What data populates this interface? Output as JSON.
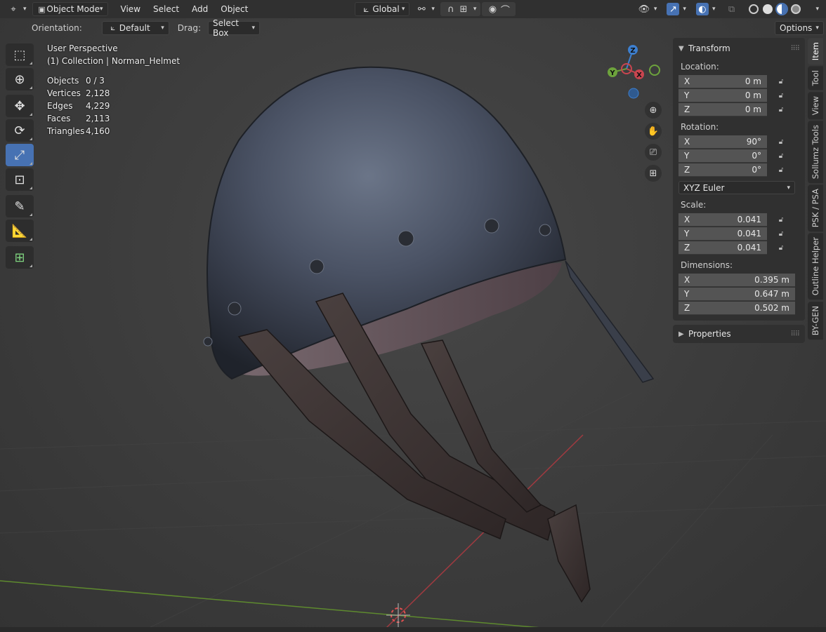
{
  "header": {
    "mode": "Object Mode",
    "menus": [
      "View",
      "Select",
      "Add",
      "Object"
    ],
    "transform_orientation": "Global"
  },
  "tool_settings": {
    "orientation_label": "Orientation:",
    "orientation_value": "Default",
    "drag_label": "Drag:",
    "drag_value": "Select Box",
    "options_label": "Options"
  },
  "overlay": {
    "perspective": "User Perspective",
    "collection": "(1) Collection | Norman_Helmet",
    "stats": [
      {
        "label": "Objects",
        "value": "0 / 3"
      },
      {
        "label": "Vertices",
        "value": "2,128"
      },
      {
        "label": "Edges",
        "value": "4,229"
      },
      {
        "label": "Faces",
        "value": "2,113"
      },
      {
        "label": "Triangles",
        "value": "4,160"
      }
    ]
  },
  "gizmo": {
    "x": "X",
    "y": "Y",
    "z": "Z"
  },
  "transform_panel": {
    "title": "Transform",
    "location_label": "Location:",
    "location": [
      {
        "axis": "X",
        "value": "0 m"
      },
      {
        "axis": "Y",
        "value": "0 m"
      },
      {
        "axis": "Z",
        "value": "0 m"
      }
    ],
    "rotation_label": "Rotation:",
    "rotation": [
      {
        "axis": "X",
        "value": "90°"
      },
      {
        "axis": "Y",
        "value": "0°"
      },
      {
        "axis": "Z",
        "value": "0°"
      }
    ],
    "rotation_mode": "XYZ Euler",
    "scale_label": "Scale:",
    "scale": [
      {
        "axis": "X",
        "value": "0.041"
      },
      {
        "axis": "Y",
        "value": "0.041"
      },
      {
        "axis": "Z",
        "value": "0.041"
      }
    ],
    "dimensions_label": "Dimensions:",
    "dimensions": [
      {
        "axis": "X",
        "value": "0.395 m"
      },
      {
        "axis": "Y",
        "value": "0.647 m"
      },
      {
        "axis": "Z",
        "value": "0.502 m"
      }
    ]
  },
  "properties_panel": {
    "title": "Properties"
  },
  "sidebar_tabs": [
    "Item",
    "Tool",
    "View",
    "Sollumz Tools",
    "PSK / PSA",
    "Outline Helper",
    "BY-GEN"
  ],
  "colors": {
    "accent": "#4772b3",
    "x_axis": "#c9454f",
    "y_axis": "#6da33c",
    "z_axis": "#3d7fcf"
  }
}
